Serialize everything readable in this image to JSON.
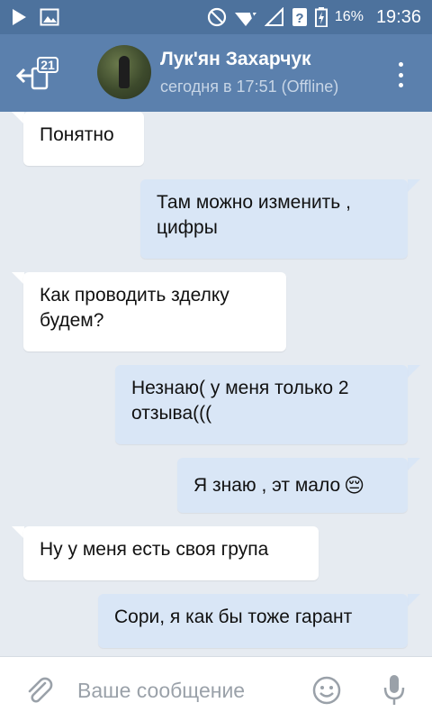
{
  "status_bar": {
    "battery_percent": "16%",
    "time": "19:36"
  },
  "header": {
    "unread_count": "21",
    "contact_name": "Лук'ян Захарчук",
    "contact_status": "сегодня в 17:51 (Offline)"
  },
  "messages": [
    {
      "direction": "in",
      "text": "Понятно"
    },
    {
      "direction": "out",
      "text": "Там можно изменить , цифры"
    },
    {
      "direction": "in",
      "text": "Как проводить зделку будем?"
    },
    {
      "direction": "out",
      "text": "Незнаю( у меня только 2 отзыва((("
    },
    {
      "direction": "out",
      "text": "Я знаю , эт мало",
      "emoji": "😔"
    },
    {
      "direction": "in",
      "text": "Ну у меня есть своя групa"
    },
    {
      "direction": "out",
      "text": "Сори, я как бы тоже гарант"
    }
  ],
  "composer": {
    "placeholder": "Ваше сообщение"
  },
  "colors": {
    "status_bar": "#4d729d",
    "toolbar": "#5b80ad",
    "chat_background": "#e6ebf1",
    "incoming_bubble": "#ffffff",
    "outgoing_bubble": "#d9e6f6"
  }
}
